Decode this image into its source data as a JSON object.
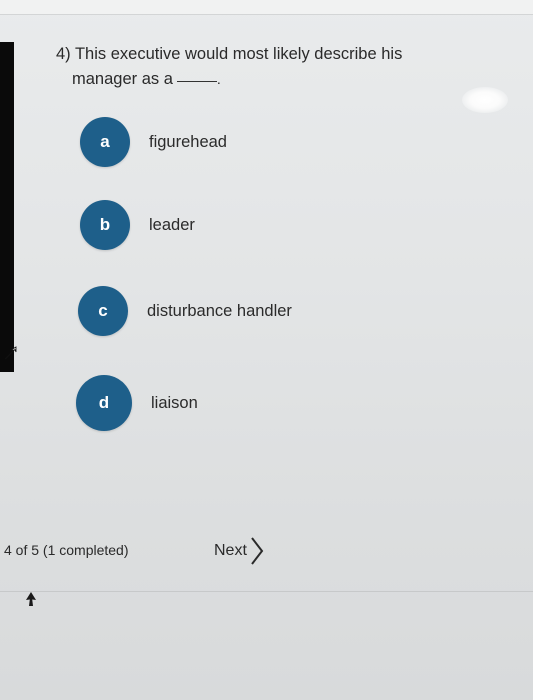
{
  "question": {
    "line1": "4) This executive would most likely describe his",
    "line2": "manager as a"
  },
  "options": [
    {
      "letter": "a",
      "label": "figurehead"
    },
    {
      "letter": "b",
      "label": "leader"
    },
    {
      "letter": "c",
      "label": "disturbance handler"
    },
    {
      "letter": "d",
      "label": "liaison"
    }
  ],
  "footer": {
    "progress": "4 of 5 (1 completed)",
    "next_label": "Next"
  },
  "colors": {
    "bubble": "#1e5f8a",
    "background": "#e3e5e6"
  }
}
